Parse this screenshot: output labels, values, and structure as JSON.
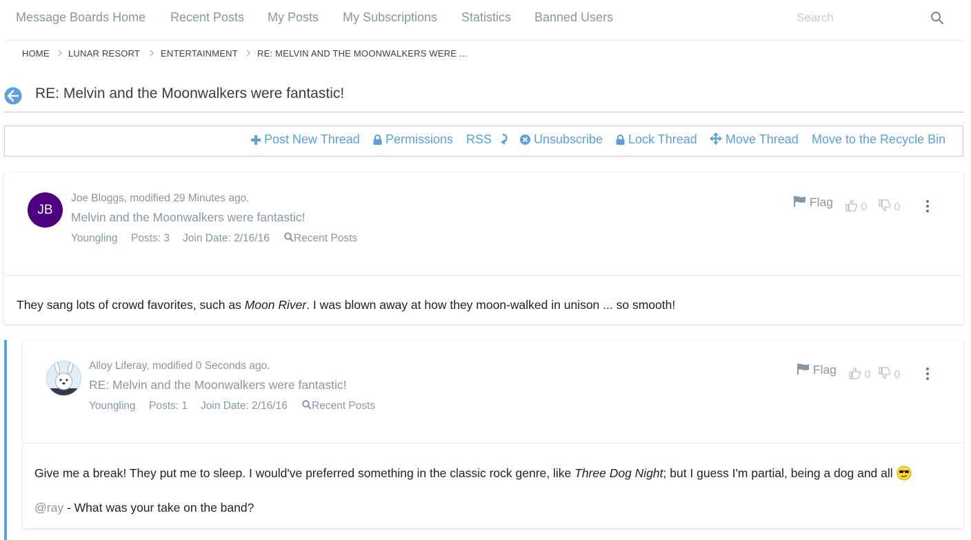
{
  "nav": {
    "items": [
      "Message Boards Home",
      "Recent Posts",
      "My Posts",
      "My Subscriptions",
      "Statistics",
      "Banned Users"
    ],
    "search_placeholder": "Search"
  },
  "breadcrumb": [
    "HOME",
    "LUNAR RESORT",
    "ENTERTAINMENT",
    "RE: MELVIN AND THE MOONWALKERS WERE ..."
  ],
  "header": {
    "title": "RE: Melvin and the Moonwalkers were fantastic!"
  },
  "toolbar": {
    "post_new_thread": "Post New Thread",
    "permissions": "Permissions",
    "rss": "RSS",
    "unsubscribe": "Unsubscribe",
    "lock_thread": "Lock Thread",
    "move_thread": "Move Thread",
    "recycle_bin": "Move to the Recycle Bin"
  },
  "colors": {
    "accent": "#5aa0dd",
    "muted": "#8a95a5",
    "avatar_bg": "#4d0080"
  },
  "posts": [
    {
      "avatar_initials": "JB",
      "meta": "Joe Bloggs, modified 29 Minutes ago.",
      "subject": "Melvin and the Moonwalkers were fantastic!",
      "rank": "Youngling",
      "posts": "Posts: 3",
      "join_date": "Join Date: 2/16/16",
      "recent_posts": "Recent Posts",
      "flag": "Flag",
      "thumbs_up": "0",
      "thumbs_down": "0",
      "body": {
        "before": "They sang lots of crowd favorites, such as ",
        "em": "Moon River",
        "after": ". I was blown away at how they moon-walked in unison ... so smooth!"
      }
    },
    {
      "avatar_icon": "dog-avatar",
      "meta": "Alloy Liferay, modified 0 Seconds ago.",
      "subject": "RE: Melvin and the Moonwalkers were fantastic!",
      "rank": "Youngling",
      "posts": "Posts: 1",
      "join_date": "Join Date: 2/16/16",
      "recent_posts": "Recent Posts",
      "flag": "Flag",
      "thumbs_up": "0",
      "thumbs_down": "0",
      "body": {
        "before": "Give me a break! They put me to sleep. I would've preferred something in the classic rock genre, like ",
        "em": "Three Dog Night",
        "after": "; but I guess I'm partial, being a dog and all ",
        "emoji_icon": "sunglasses-emoji",
        "mention": "@ray",
        "line2": " - What was your take on the band?"
      }
    }
  ]
}
